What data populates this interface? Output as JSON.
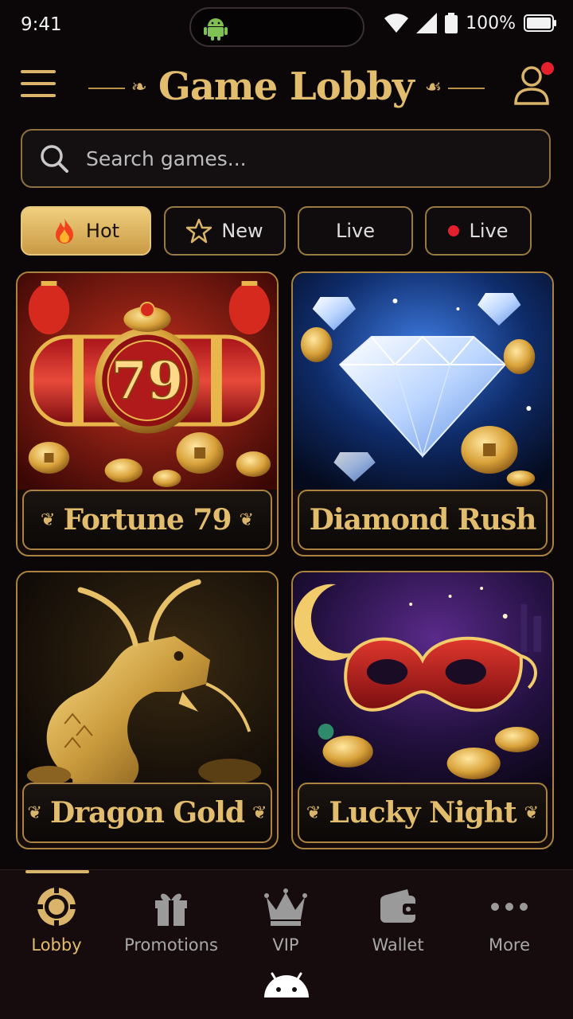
{
  "status_bar": {
    "time": "9:41",
    "battery": "100%",
    "icons": [
      "android-icon",
      "wifi-icon",
      "signal-icon",
      "battery-icon"
    ]
  },
  "header": {
    "title": "Game Lobby",
    "menu_icon": "hamburger-icon",
    "user_icon": "user-icon",
    "has_notification": true
  },
  "search": {
    "placeholder": "Search games..."
  },
  "filters": [
    {
      "label": "Hot",
      "icon": "flame-icon",
      "active": true
    },
    {
      "label": "New",
      "icon": "star-icon",
      "active": false
    },
    {
      "label": "Live",
      "icon": "",
      "active": false
    },
    {
      "label": "Live",
      "icon": "live-dot",
      "active": false
    }
  ],
  "games": [
    {
      "name": "Fortune 79",
      "art": "slot-reel-79"
    },
    {
      "name": "Diamond Rush",
      "art": "diamond"
    },
    {
      "name": "Dragon Gold",
      "art": "golden-dragon"
    },
    {
      "name": "Lucky Night",
      "art": "masquerade-mask"
    }
  ],
  "reel_number": "79",
  "bottom_nav": [
    {
      "label": "Lobby",
      "icon": "chip-icon",
      "active": true
    },
    {
      "label": "Promotions",
      "icon": "gift-icon",
      "active": false
    },
    {
      "label": "VIP",
      "icon": "crown-icon",
      "active": false
    },
    {
      "label": "Wallet",
      "icon": "wallet-icon",
      "active": false
    },
    {
      "label": "More",
      "icon": "more-icon",
      "active": false
    }
  ],
  "colors": {
    "gold": "#d9b46a",
    "background": "#0b0708",
    "accent_red": "#e3202b"
  }
}
